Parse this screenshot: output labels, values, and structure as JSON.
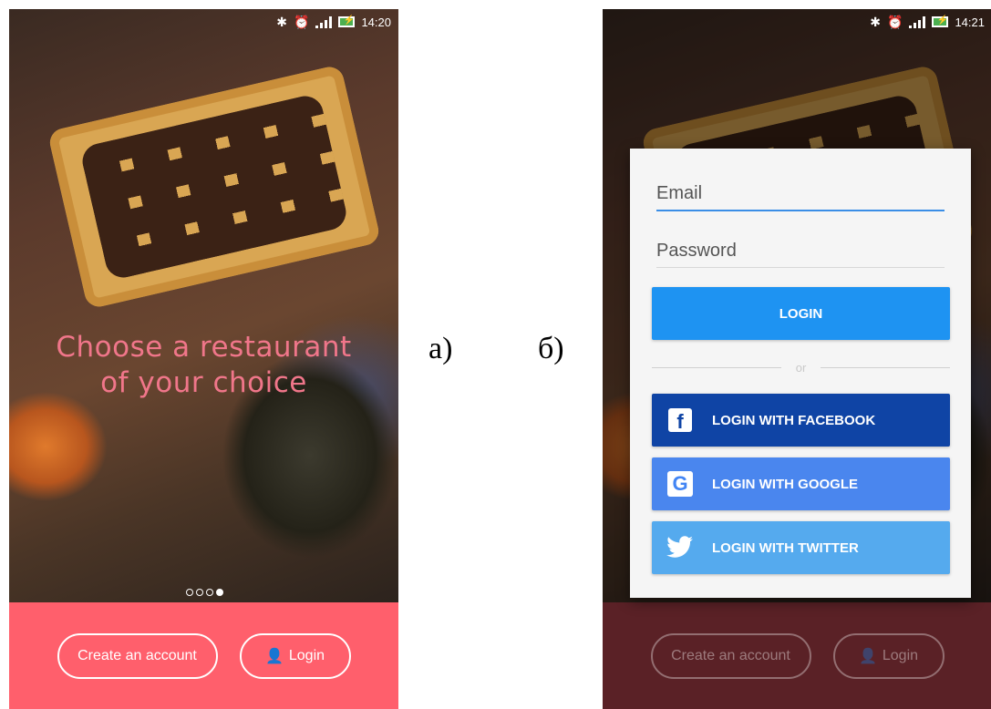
{
  "captions": {
    "a": "а)",
    "b": "б)"
  },
  "screen_a": {
    "status_time": "14:20",
    "tagline_line1": "Choose a restaurant",
    "tagline_line2": "of your choice",
    "carousel": {
      "total": 4,
      "active_index": 4
    },
    "create_account_label": "Create an account",
    "login_label": "Login"
  },
  "screen_b": {
    "status_time": "14:21",
    "email_placeholder": "Email",
    "password_placeholder": "Password",
    "login_button": "LOGIN",
    "divider_text": "or",
    "facebook_button": "LOGIN WITH FACEBOOK",
    "google_button": "LOGIN WITH GOOGLE",
    "twitter_button": "LOGIN WITH TWITTER",
    "create_account_label": "Create an account",
    "login_label": "Login"
  },
  "colors": {
    "accent_pink": "#ff5f6c",
    "tagline_pink": "#f0768a",
    "login_blue": "#1e93f2",
    "facebook": "#0f44a5",
    "google": "#4a86ee",
    "twitter": "#55aaee"
  },
  "icons": [
    "bluetooth-icon",
    "alarm-icon",
    "signal-icon",
    "battery-icon",
    "user-icon",
    "facebook-icon",
    "google-icon",
    "twitter-icon"
  ]
}
